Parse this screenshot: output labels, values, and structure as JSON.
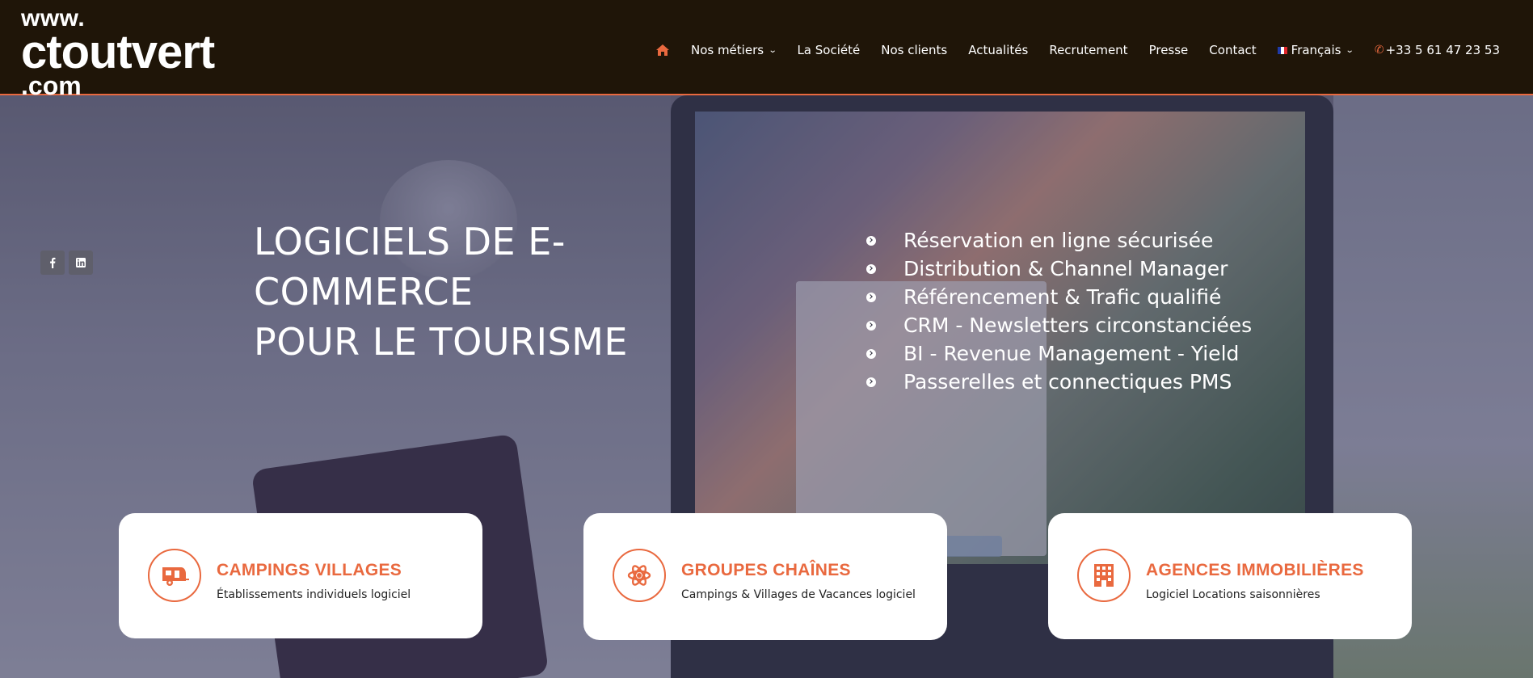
{
  "header": {
    "logo": {
      "line1": "www.",
      "line2": "ctoutvert",
      "line3": ".com"
    },
    "nav": {
      "home_icon": "home-icon",
      "items": [
        {
          "label": "Nos métiers",
          "has_dropdown": true
        },
        {
          "label": "La Société"
        },
        {
          "label": "Nos clients"
        },
        {
          "label": "Actualités"
        },
        {
          "label": "Recrutement"
        },
        {
          "label": "Presse"
        },
        {
          "label": "Contact"
        }
      ],
      "language": {
        "label": "Français",
        "flag": "france-flag-icon"
      },
      "phone": {
        "label": "+33 5 61 47 23 53",
        "icon": "phone-icon"
      }
    },
    "accent_color": "#e9693f",
    "background_color": "#1f1508"
  },
  "social": [
    {
      "name": "facebook",
      "icon": "facebook-icon"
    },
    {
      "name": "linkedin",
      "icon": "linkedin-icon"
    }
  ],
  "hero": {
    "title_line1": "LOGICIELS DE E-",
    "title_line2": "COMMERCE",
    "title_line3": "POUR LE TOURISME",
    "features": [
      "Réservation en ligne sécurisée",
      "Distribution & Channel Manager",
      "Référencement & Trafic qualifié",
      "CRM - Newsletters circonstanciées",
      "BI - Revenue Management - Yield",
      "Passerelles et connectiques PMS"
    ]
  },
  "cards": [
    {
      "title": "CAMPINGS VILLAGES",
      "subtitle": "Établissements individuels logiciel",
      "icon": "caravan-icon"
    },
    {
      "title": "GROUPES CHAÎNES",
      "subtitle": "Campings & Villages de Vacances logiciel",
      "icon": "atom-icon"
    },
    {
      "title": "AGENCES IMMOBILIÈRES",
      "subtitle": "Logiciel Locations saisonnières",
      "icon": "building-icon"
    }
  ]
}
